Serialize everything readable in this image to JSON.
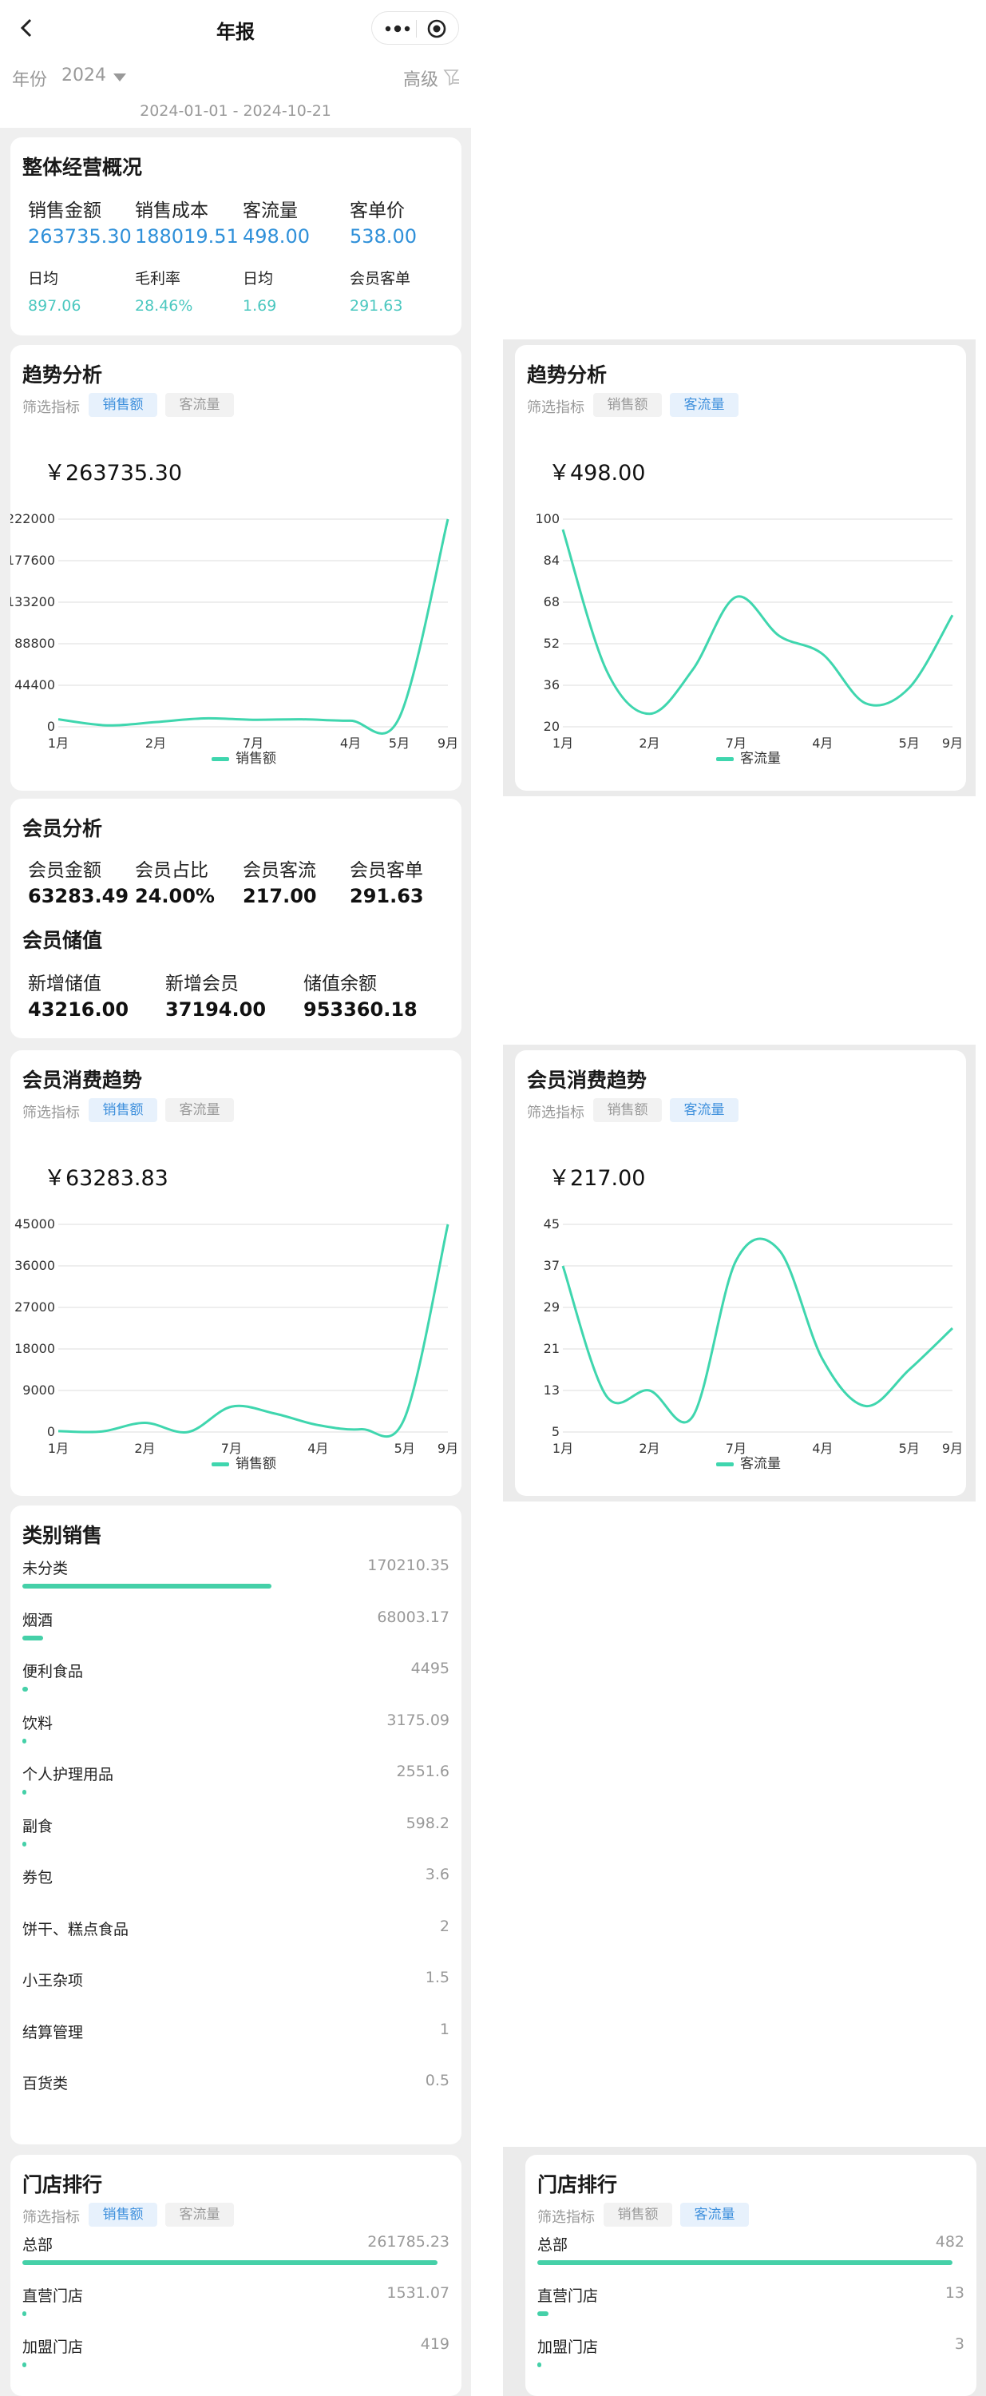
{
  "nav": {
    "title": "年报",
    "more_icon": "more-dots-icon",
    "target_icon": "target-icon"
  },
  "filter_bar": {
    "year_label": "年份",
    "year_value": "2024",
    "advanced": "高级",
    "date_range": "2024-01-01 - 2024-10-21"
  },
  "overview": {
    "title": "整体经营概况",
    "metrics": [
      {
        "label": "销售金额",
        "value": "263735.30"
      },
      {
        "label": "销售成本",
        "value": "188019.51"
      },
      {
        "label": "客流量",
        "value": "498.00"
      },
      {
        "label": "客单价",
        "value": "538.00"
      }
    ],
    "sub_metrics": [
      {
        "label": "日均",
        "value": "897.06"
      },
      {
        "label": "毛利率",
        "value": "28.46%"
      },
      {
        "label": "日均",
        "value": "1.69"
      },
      {
        "label": "会员客单",
        "value": "291.63"
      }
    ]
  },
  "trend_sales": {
    "title": "趋势分析",
    "filter_label": "筛选指标",
    "chip_sales": "销售额",
    "chip_traffic": "客流量",
    "total": "￥263735.30",
    "legend": "销售额"
  },
  "trend_traffic": {
    "title": "趋势分析",
    "filter_label": "筛选指标",
    "chip_sales": "销售额",
    "chip_traffic": "客流量",
    "total": "￥498.00",
    "legend": "客流量"
  },
  "member": {
    "title": "会员分析",
    "metrics": [
      {
        "label": "会员金额",
        "value": "63283.49"
      },
      {
        "label": "会员占比",
        "value": "24.00%"
      },
      {
        "label": "会员客流",
        "value": "217.00"
      },
      {
        "label": "会员客单",
        "value": "291.63"
      }
    ],
    "stored_title": "会员储值",
    "stored": [
      {
        "label": "新增储值",
        "value": "43216.00"
      },
      {
        "label": "新增会员",
        "value": "37194.00"
      },
      {
        "label": "储值余额",
        "value": "953360.18"
      }
    ]
  },
  "member_trend_sales": {
    "title": "会员消费趋势",
    "filter_label": "筛选指标",
    "chip_sales": "销售额",
    "chip_traffic": "客流量",
    "total": "￥63283.83",
    "legend": "销售额"
  },
  "member_trend_traffic": {
    "title": "会员消费趋势",
    "filter_label": "筛选指标",
    "chip_sales": "销售额",
    "chip_traffic": "客流量",
    "total": "￥217.00",
    "legend": "客流量"
  },
  "category": {
    "title": "类别销售",
    "items": [
      {
        "name": "未分类",
        "value": "170210.35",
        "ratio": 0.6
      },
      {
        "name": "烟酒",
        "value": "68003.17",
        "ratio": 0.05
      },
      {
        "name": "便利食品",
        "value": "4495",
        "ratio": 0.013
      },
      {
        "name": "饮料",
        "value": "3175.09",
        "ratio": 0.01
      },
      {
        "name": "个人护理用品",
        "value": "2551.6",
        "ratio": 0.008
      },
      {
        "name": "副食",
        "value": "598.2",
        "ratio": 0.004
      },
      {
        "name": "券包",
        "value": "3.6",
        "ratio": 0
      },
      {
        "name": "饼干、糕点食品",
        "value": "2",
        "ratio": 0
      },
      {
        "name": "小王杂项",
        "value": "1.5",
        "ratio": 0
      },
      {
        "name": "结算管理",
        "value": "1",
        "ratio": 0
      },
      {
        "name": "百货类",
        "value": "0.5",
        "ratio": 0
      }
    ]
  },
  "store_rank_sales": {
    "title": "门店排行",
    "filter_label": "筛选指标",
    "chip_sales": "销售额",
    "chip_traffic": "客流量",
    "items": [
      {
        "name": "总部",
        "value": "261785.23",
        "ratio": 1.0
      },
      {
        "name": "直营门店",
        "value": "1531.07",
        "ratio": 0.006
      },
      {
        "name": "加盟门店",
        "value": "419",
        "ratio": 0.003
      }
    ]
  },
  "store_rank_traffic": {
    "title": "门店排行",
    "filter_label": "筛选指标",
    "chip_sales": "销售额",
    "chip_traffic": "客流量",
    "items": [
      {
        "name": "总部",
        "value": "482",
        "ratio": 1.0
      },
      {
        "name": "直营门店",
        "value": "13",
        "ratio": 0.027
      },
      {
        "name": "加盟门店",
        "value": "3",
        "ratio": 0.006
      }
    ]
  },
  "chart_data": [
    {
      "type": "line",
      "title": "趋势分析",
      "series": [
        {
          "name": "销售额",
          "values": [
            8000,
            1500,
            5000,
            9000,
            7500,
            8000,
            6500,
            9500,
            222000
          ]
        }
      ],
      "x": [
        "1月",
        "",
        "2月",
        "",
        "7月",
        "",
        "4月",
        "5月",
        "9月"
      ],
      "x_tick_labels": [
        "1月",
        "2月",
        "7月",
        "4月",
        "5月",
        "9月"
      ],
      "y_ticks": [
        0,
        44400,
        88800,
        133200,
        177600,
        222000
      ],
      "ylim": [
        0,
        222000
      ]
    },
    {
      "type": "line",
      "title": "趋势分析",
      "series": [
        {
          "name": "客流量",
          "values": [
            96,
            42,
            25,
            42,
            70,
            55,
            48,
            29,
            35,
            63
          ]
        }
      ],
      "x": [
        "1月",
        "",
        "2月",
        "",
        "7月",
        "",
        "4月",
        "",
        "5月",
        "9月"
      ],
      "x_tick_labels": [
        "1月",
        "2月",
        "7月",
        "4月",
        "5月",
        "9月"
      ],
      "y_ticks": [
        20,
        36,
        52,
        68,
        84,
        100
      ],
      "ylim": [
        20,
        100
      ]
    },
    {
      "type": "line",
      "title": "会员消费趋势",
      "series": [
        {
          "name": "销售额",
          "values": [
            200,
            100,
            2000,
            0,
            5500,
            4000,
            1500,
            600,
            3000,
            45000
          ]
        }
      ],
      "x": [
        "1月",
        "",
        "2月",
        "",
        "7月",
        "",
        "4月",
        "",
        "5月",
        "9月"
      ],
      "x_tick_labels": [
        "1月",
        "2月",
        "7月",
        "4月",
        "5月",
        "9月"
      ],
      "y_ticks": [
        0,
        9000,
        18000,
        27000,
        36000,
        45000
      ],
      "ylim": [
        0,
        45000
      ]
    },
    {
      "type": "line",
      "title": "会员消费趋势",
      "series": [
        {
          "name": "客流量",
          "values": [
            37,
            12,
            13,
            8,
            38,
            40,
            19,
            10,
            17,
            25
          ]
        }
      ],
      "x": [
        "1月",
        "",
        "2月",
        "",
        "7月",
        "",
        "4月",
        "",
        "5月",
        "9月"
      ],
      "x_tick_labels": [
        "1月",
        "2月",
        "7月",
        "4月",
        "5月",
        "9月"
      ],
      "y_ticks": [
        5,
        13,
        21,
        29,
        37,
        45
      ],
      "ylim": [
        5,
        45
      ]
    }
  ]
}
